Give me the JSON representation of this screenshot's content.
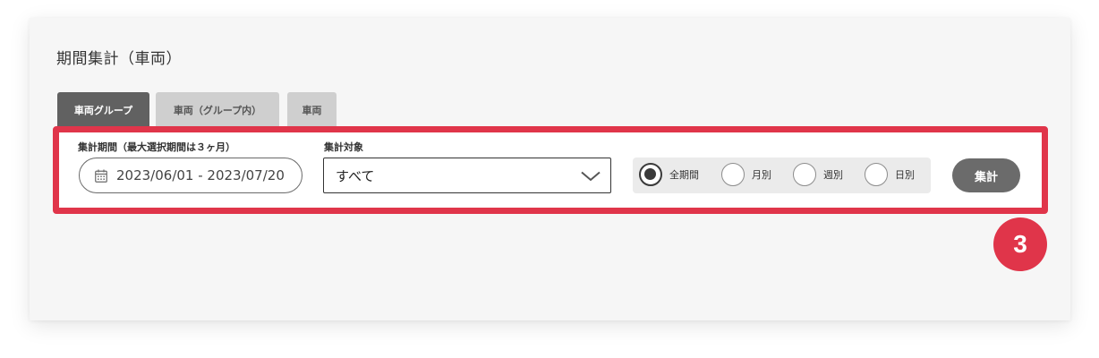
{
  "page": {
    "title": "期間集計（車両）"
  },
  "tabs": [
    {
      "label": "車両グループ",
      "active": true
    },
    {
      "label": "車両（グループ内）",
      "active": false
    },
    {
      "label": "車両",
      "active": false
    }
  ],
  "filters": {
    "period_label": "集計期間（最大選択期間は３ヶ月）",
    "date_range_value": "2023/06/01 - 2023/07/20",
    "target_label": "集計対象",
    "target_value": "すべて",
    "radio_options": [
      {
        "label": "全期間",
        "checked": true
      },
      {
        "label": "月別",
        "checked": false
      },
      {
        "label": "週別",
        "checked": false
      },
      {
        "label": "日別",
        "checked": false
      }
    ],
    "submit_label": "集計"
  },
  "badge": {
    "number": "3",
    "color": "#e0354a"
  },
  "icons": {
    "date": "calendar-icon",
    "select": "chevron-down-icon"
  },
  "colors": {
    "highlight": "#e0354a",
    "tab_active": "#616161",
    "tab_inactive": "#cfcfcf",
    "button": "#6b6b6b"
  }
}
